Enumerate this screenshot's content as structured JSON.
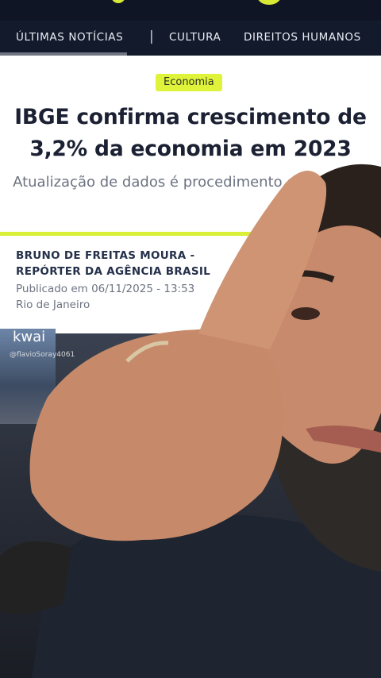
{
  "nav": {
    "items": [
      "ÚLTIMAS NOTÍCIAS",
      "|",
      "CULTURA",
      "DIREITOS HUMANOS"
    ]
  },
  "article": {
    "category": "Economia",
    "headline": "IBGE confirma crescimento de 3,2% da economia em 2023",
    "subtitle": "Atualização de dados é procedimento do instituto",
    "author": "BRUNO DE FREITAS MOURA - REPÓRTER DA AGÊNCIA BRASIL",
    "published": "Publicado em 06/11/2025 - 13:53",
    "location": "Rio de Janeiro"
  },
  "overlay": {
    "app": "kwai",
    "user": "@flavioSoray4061"
  },
  "colors": {
    "accent": "#d9ef38",
    "nav_bg": "#131a2c"
  },
  "icons": [
    "share-icon",
    "kwai-logo"
  ]
}
